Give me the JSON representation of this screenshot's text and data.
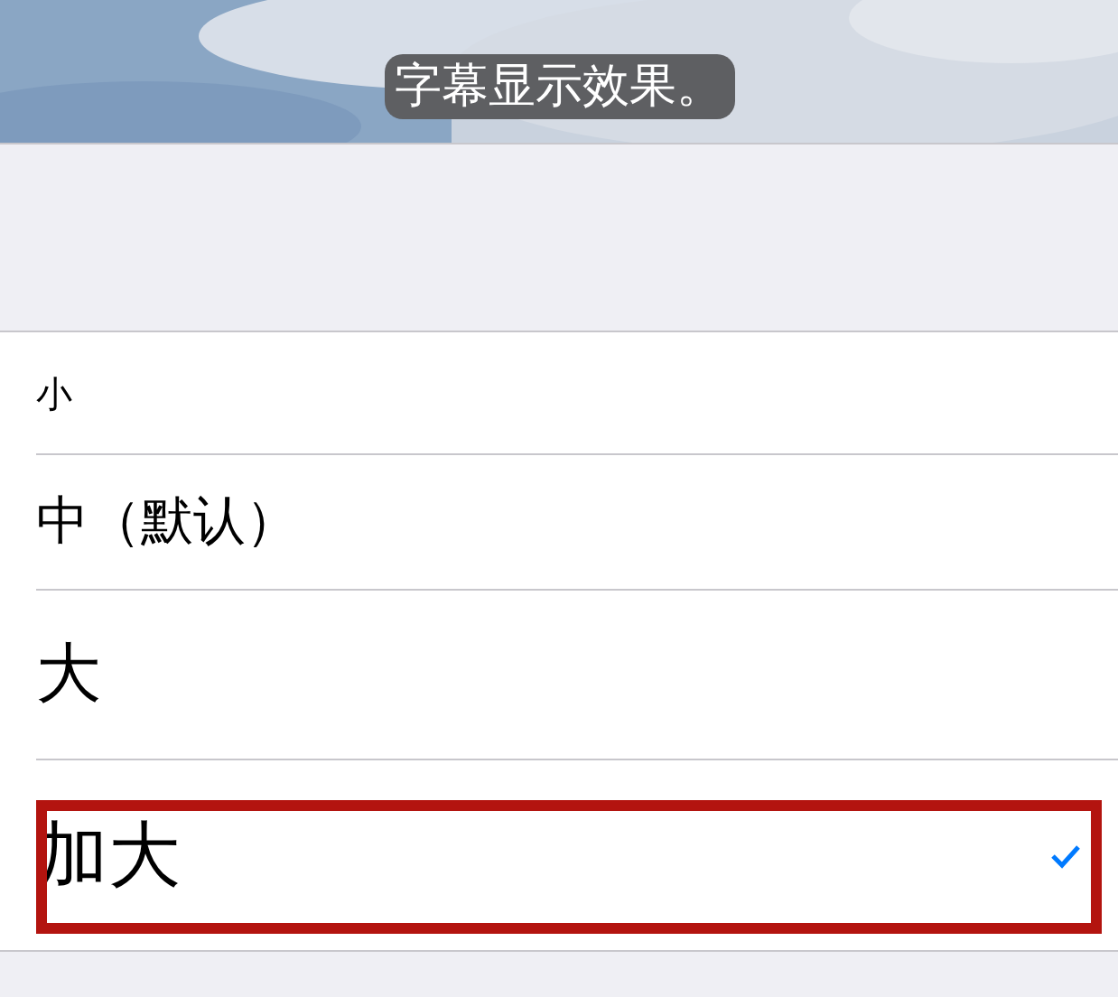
{
  "preview": {
    "caption": "字幕显示效果。"
  },
  "sizes": [
    {
      "label": "小",
      "kind": "small",
      "selected": false,
      "highlighted": false
    },
    {
      "label": "中（默认）",
      "kind": "medium",
      "selected": false,
      "highlighted": false
    },
    {
      "label": "大",
      "kind": "large",
      "selected": false,
      "highlighted": false
    },
    {
      "label": "加大",
      "kind": "xlarge",
      "selected": true,
      "highlighted": true
    }
  ]
}
